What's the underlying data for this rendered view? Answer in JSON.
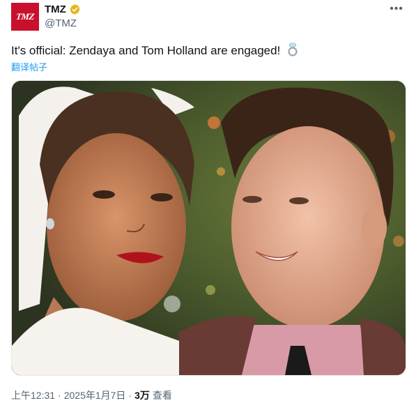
{
  "author": {
    "avatar_text": "TMZ",
    "display_name": "TMZ",
    "handle": "@TMZ",
    "verified": true,
    "verified_color": "#e2b719"
  },
  "more_icon": "more-horizontal-icon",
  "tweet": {
    "text": "It's official: Zendaya and Tom Holland are engaged!",
    "emoji": "ring-emoji",
    "translate_label": "翻译帖子"
  },
  "media": {
    "description_icon": "photo"
  },
  "meta": {
    "time": "上午12:31",
    "separator": "·",
    "date": "2025年1月7日",
    "views_count": "3万",
    "views_label": "查看"
  },
  "colors": {
    "brand": "#c8102e",
    "link": "#1d9bf0",
    "secondary_text": "#536471"
  }
}
